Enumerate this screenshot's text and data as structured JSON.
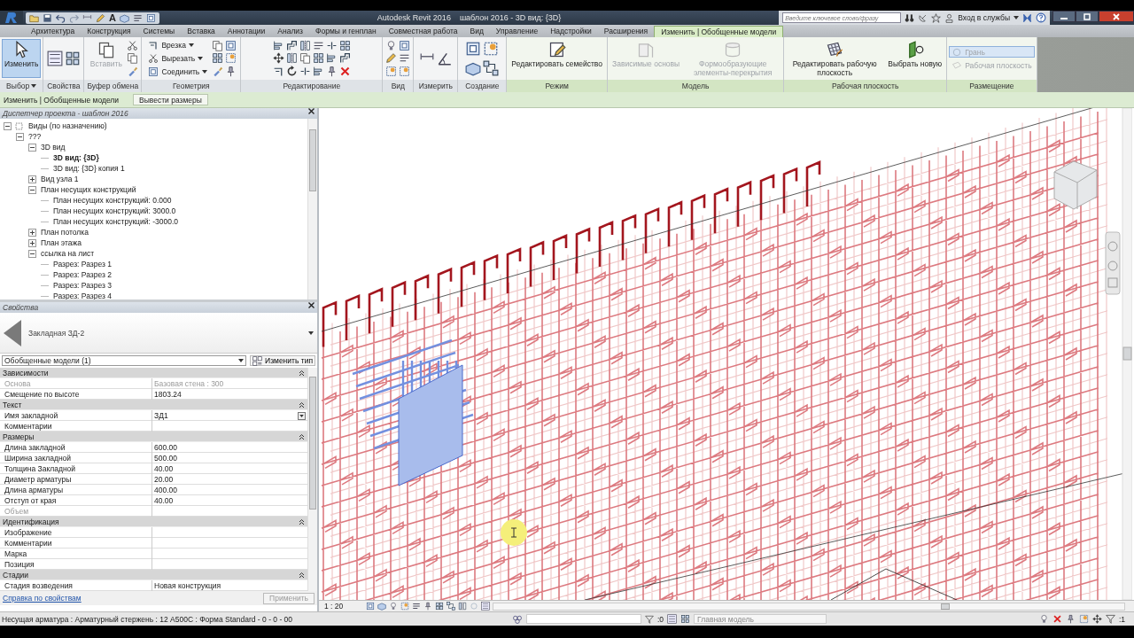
{
  "window": {
    "app_title": "Autodesk Revit 2016",
    "doc_title": "шаблон 2016 - 3D вид: {3D}",
    "text_tool_glyph": "A",
    "search_placeholder": "Введите ключевое слово/фразу",
    "signin": "Вход в службы"
  },
  "ribbon_tabs": [
    {
      "label": "Архитектура",
      "selected": false
    },
    {
      "label": "Конструкция",
      "selected": false
    },
    {
      "label": "Системы",
      "selected": false
    },
    {
      "label": "Вставка",
      "selected": false
    },
    {
      "label": "Аннотации",
      "selected": false
    },
    {
      "label": "Анализ",
      "selected": false
    },
    {
      "label": "Формы и генплан",
      "selected": false
    },
    {
      "label": "Совместная работа",
      "selected": false
    },
    {
      "label": "Вид",
      "selected": false
    },
    {
      "label": "Управление",
      "selected": false
    },
    {
      "label": "Надстройки",
      "selected": false
    },
    {
      "label": "Расширения",
      "selected": false
    },
    {
      "label": "Изменить | Обобщенные модели",
      "selected": true
    }
  ],
  "ribbon_panels": [
    {
      "title": "Выбор",
      "title_dropdown": true,
      "contextual": false,
      "tools": [
        {
          "kind": "large",
          "label": "Изменить",
          "selected": true,
          "disabled": false,
          "dropdown": false
        }
      ]
    },
    {
      "title": "Свойства",
      "title_dropdown": false,
      "contextual": false
    },
    {
      "title": "Буфер обмена",
      "title_dropdown": false,
      "contextual": false,
      "tools": [
        {
          "kind": "large",
          "label": "Вставить",
          "selected": false,
          "disabled": true,
          "dropdown": false
        }
      ]
    },
    {
      "title": "Геометрия",
      "title_dropdown": false,
      "contextual": false,
      "tools": [
        {
          "kind": "small",
          "label": "Врезка",
          "selected": false,
          "disabled": false,
          "dropdown": true
        },
        {
          "kind": "small",
          "label": "Вырезать",
          "selected": false,
          "disabled": false,
          "dropdown": true
        },
        {
          "kind": "small",
          "label": "Соединить",
          "selected": false,
          "disabled": false,
          "dropdown": true
        }
      ]
    },
    {
      "title": "Редактирование",
      "title_dropdown": false,
      "contextual": false
    },
    {
      "title": "Вид",
      "title_dropdown": false,
      "contextual": false
    },
    {
      "title": "Измерить",
      "title_dropdown": false,
      "contextual": false
    },
    {
      "title": "Создание",
      "title_dropdown": false,
      "contextual": false
    },
    {
      "title": "Режим",
      "title_dropdown": false,
      "contextual": true,
      "tools": [
        {
          "kind": "large",
          "label": "Редактировать семейство",
          "selected": false,
          "disabled": false,
          "dropdown": false
        }
      ]
    },
    {
      "title": "Модель",
      "title_dropdown": false,
      "contextual": true,
      "tools": [
        {
          "kind": "large",
          "label": "Зависимые основы",
          "selected": false,
          "disabled": true,
          "dropdown": false
        },
        {
          "kind": "large",
          "label": "Формообразующие элементы-перекрытия",
          "selected": false,
          "disabled": true,
          "dropdown": false
        }
      ]
    },
    {
      "title": "Рабочая плоскость",
      "title_dropdown": false,
      "contextual": true,
      "tools": [
        {
          "kind": "large",
          "label": "Редактировать рабочую плоскость",
          "selected": false,
          "disabled": false,
          "dropdown": false
        },
        {
          "kind": "large",
          "label": "Выбрать новую",
          "selected": false,
          "disabled": false,
          "dropdown": false
        }
      ]
    },
    {
      "title": "Размещение",
      "title_dropdown": false,
      "contextual": true,
      "tools": [
        {
          "kind": "small",
          "label": "Грань",
          "selected": true,
          "disabled": true,
          "dropdown": false
        },
        {
          "kind": "small",
          "label": "Рабочая плоскость",
          "selected": false,
          "disabled": true,
          "dropdown": false
        }
      ]
    }
  ],
  "options_bar": {
    "context": "Изменить | Обобщенные модели",
    "button": "Вывести размеры"
  },
  "project_browser": {
    "title": "Диспетчер проекта - шаблон 2016",
    "tree": [
      {
        "label": "Виды (по назначению)",
        "expanded": true,
        "selected": false,
        "children": [
          {
            "label": "???",
            "expanded": true,
            "selected": false,
            "children": [
              {
                "label": "3D вид",
                "expanded": true,
                "selected": false,
                "children": [
                  {
                    "label": "3D вид: {3D}",
                    "selected": true
                  },
                  {
                    "label": "3D вид: {3D} копия 1",
                    "selected": false
                  }
                ]
              },
              {
                "label": "Вид узла 1",
                "expanded": false,
                "selected": false
              },
              {
                "label": "План несущих конструкций",
                "expanded": true,
                "selected": false,
                "children": [
                  {
                    "label": "План несущих конструкций: 0.000",
                    "selected": false
                  },
                  {
                    "label": "План несущих конструкций: 3000.0",
                    "selected": false
                  },
                  {
                    "label": "План несущих конструкций: -3000.0",
                    "selected": false
                  }
                ]
              },
              {
                "label": "План потолка",
                "expanded": false,
                "selected": false
              },
              {
                "label": "План этажа",
                "expanded": false,
                "selected": false
              },
              {
                "label": "ссылка на лист",
                "expanded": true,
                "selected": false,
                "children": [
                  {
                    "label": "Разрез: Разрез 1",
                    "selected": false
                  },
                  {
                    "label": "Разрез: Разрез 2",
                    "selected": false
                  },
                  {
                    "label": "Разрез: Разрез 3",
                    "selected": false
                  },
                  {
                    "label": "Разрез: Разрез 4",
                    "selected": false
                  }
                ]
              }
            ]
          }
        ]
      }
    ]
  },
  "properties": {
    "title": "Свойства",
    "type_name": "Закладная ЗД-2",
    "filter": "Обобщенные модели (1)",
    "edit_type": "Изменить тип",
    "groups": [
      {
        "name": "Зависимости",
        "expanded": true,
        "rows": [
          {
            "label": "Основа",
            "value": "Базовая стена : 300",
            "disabled": true,
            "kind": "text"
          },
          {
            "label": "Смещение по высоте",
            "value": "1803.24",
            "disabled": false,
            "kind": "text"
          }
        ]
      },
      {
        "name": "Текст",
        "expanded": true,
        "rows": [
          {
            "label": "Имя закладной",
            "value": "ЗД1",
            "disabled": false,
            "kind": "dropdown"
          },
          {
            "label": "Комментарии",
            "disabled": false,
            "kind": "text"
          }
        ]
      },
      {
        "name": "Размеры",
        "expanded": true,
        "rows": [
          {
            "label": "Длина закладной",
            "value": "600.00",
            "disabled": false,
            "kind": "text"
          },
          {
            "label": "Ширина закладной",
            "value": "500.00",
            "disabled": false,
            "kind": "text"
          },
          {
            "label": "Толщина Закладной",
            "value": "40.00",
            "disabled": false,
            "kind": "text"
          },
          {
            "label": "Диаметр арматуры",
            "value": "20.00",
            "disabled": false,
            "kind": "text"
          },
          {
            "label": "Длина арматуры",
            "value": "400.00",
            "disabled": false,
            "kind": "text"
          },
          {
            "label": "Отступ от края",
            "value": "40.00",
            "disabled": false,
            "kind": "text"
          },
          {
            "label": "Объем",
            "disabled": true,
            "kind": "text"
          }
        ]
      },
      {
        "name": "Идентификация",
        "expanded": true,
        "rows": [
          {
            "label": "Изображение",
            "disabled": false,
            "kind": "text"
          },
          {
            "label": "Комментарии",
            "disabled": false,
            "kind": "text"
          },
          {
            "label": "Марка",
            "disabled": false,
            "kind": "text"
          },
          {
            "label": "Позиция",
            "disabled": false,
            "kind": "text"
          }
        ]
      },
      {
        "name": "Стадии",
        "expanded": true,
        "rows": [
          {
            "label": "Стадия возведения",
            "value": "Новая конструкция",
            "disabled": false,
            "kind": "text"
          }
        ]
      }
    ],
    "help_link": "Справка по свойствам",
    "apply": "Применить",
    "apply_disabled": true
  },
  "view_control": {
    "scale": "1 : 20"
  },
  "status_bar": {
    "message": "Несущая арматура : Арматурный стержень : 12 А500С : Форма Standard - 0 - 0 - 00",
    "selection_count": ":0",
    "model": "Главная модель",
    "filter_count": ":1"
  }
}
